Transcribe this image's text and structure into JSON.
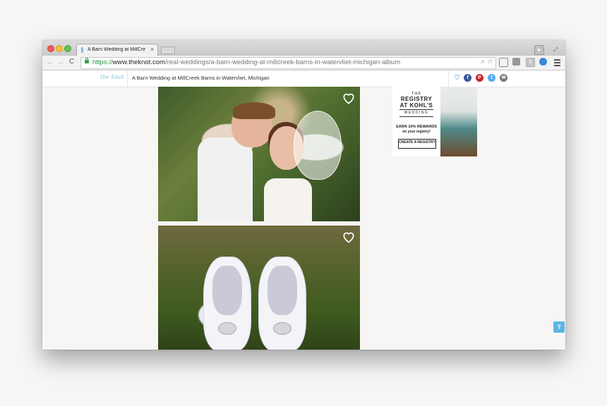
{
  "browser": {
    "tab": {
      "title": "A Barn Wedding at MillCre",
      "close": "×"
    },
    "nav": {
      "back": "←",
      "forward": "→",
      "reload": "C"
    },
    "address": {
      "scheme": "https://",
      "host": "www.theknot.com",
      "path": "/real-weddings/a-barn-wedding-at-millcreek-barns-in-watervliet-michigan-album"
    }
  },
  "site": {
    "logo": "the knot",
    "title": "A Barn Wedding at MillCreek Barns in Watervliet, Michigan",
    "share": {
      "facebook": "f",
      "pinterest": "P",
      "twitter": "t",
      "email": "✉"
    }
  },
  "ad": {
    "the": "THE",
    "registry": "REGISTRY",
    "kohls": "AT KOHL'S",
    "wedding": "WEDDING",
    "earn": "EARN 10% REWARDS",
    "on": "on your registry!",
    "button": "CREATE A REGISTRY"
  },
  "help": "?"
}
